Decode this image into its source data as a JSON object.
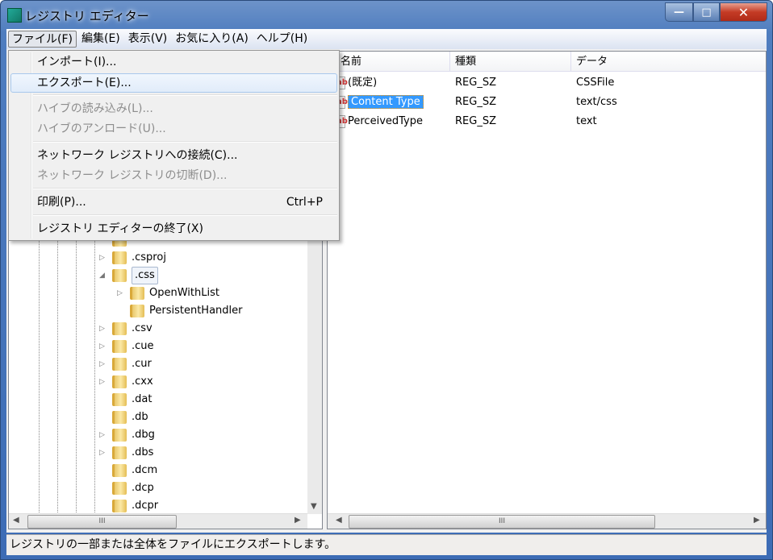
{
  "window": {
    "title": "レジストリ エディター",
    "controls": {
      "minimize": "—",
      "maximize": "□",
      "close": "✕"
    }
  },
  "menubar": [
    "ファイル(F)",
    "編集(E)",
    "表示(V)",
    "お気に入り(A)",
    "ヘルプ(H)"
  ],
  "file_menu": [
    {
      "label": "インポート(I)...",
      "enabled": true
    },
    {
      "label": "エクスポート(E)...",
      "enabled": true,
      "hovered": true
    },
    {
      "label": "ハイブの読み込み(L)...",
      "enabled": false
    },
    {
      "label": "ハイブのアンロード(U)...",
      "enabled": false
    },
    {
      "label": "ネットワーク レジストリへの接続(C)...",
      "enabled": true
    },
    {
      "label": "ネットワーク レジストリの切断(D)...",
      "enabled": false
    },
    {
      "label": "印刷(P)...",
      "shortcut": "Ctrl+P",
      "enabled": true
    },
    {
      "label": "レジストリ エディターの終了(X)",
      "enabled": true
    }
  ],
  "tree": [
    {
      "label": ".csproj",
      "expander": "▷",
      "level": 0
    },
    {
      "label": ".css",
      "expander": "◢",
      "level": 0,
      "selected": true
    },
    {
      "label": "OpenWithList",
      "expander": "▷",
      "level": 1
    },
    {
      "label": "PersistentHandler",
      "expander": "",
      "level": 1
    },
    {
      "label": ".csv",
      "expander": "▷",
      "level": 0
    },
    {
      "label": ".cue",
      "expander": "▷",
      "level": 0
    },
    {
      "label": ".cur",
      "expander": "▷",
      "level": 0
    },
    {
      "label": ".cxx",
      "expander": "▷",
      "level": 0
    },
    {
      "label": ".dat",
      "expander": "",
      "level": 0
    },
    {
      "label": ".db",
      "expander": "",
      "level": 0
    },
    {
      "label": ".dbg",
      "expander": "▷",
      "level": 0
    },
    {
      "label": ".dbs",
      "expander": "▷",
      "level": 0
    },
    {
      "label": ".dcm",
      "expander": "",
      "level": 0
    },
    {
      "label": ".dcp",
      "expander": "",
      "level": 0
    },
    {
      "label": ".dcpr",
      "expander": "",
      "level": 0
    }
  ],
  "values": {
    "columns": [
      "名前",
      "種類",
      "データ"
    ],
    "rows": [
      {
        "name": "(既定)",
        "type": "REG_SZ",
        "data": "CSSFile",
        "icon": "ab"
      },
      {
        "name": "Content Type",
        "type": "REG_SZ",
        "data": "text/css",
        "icon": "ab",
        "selected": true
      },
      {
        "name": "PerceivedType",
        "type": "REG_SZ",
        "data": "text",
        "icon": "ab"
      }
    ]
  },
  "scroll": {
    "grip": "III"
  },
  "status": "レジストリの一部または全体をファイルにエクスポートします。"
}
